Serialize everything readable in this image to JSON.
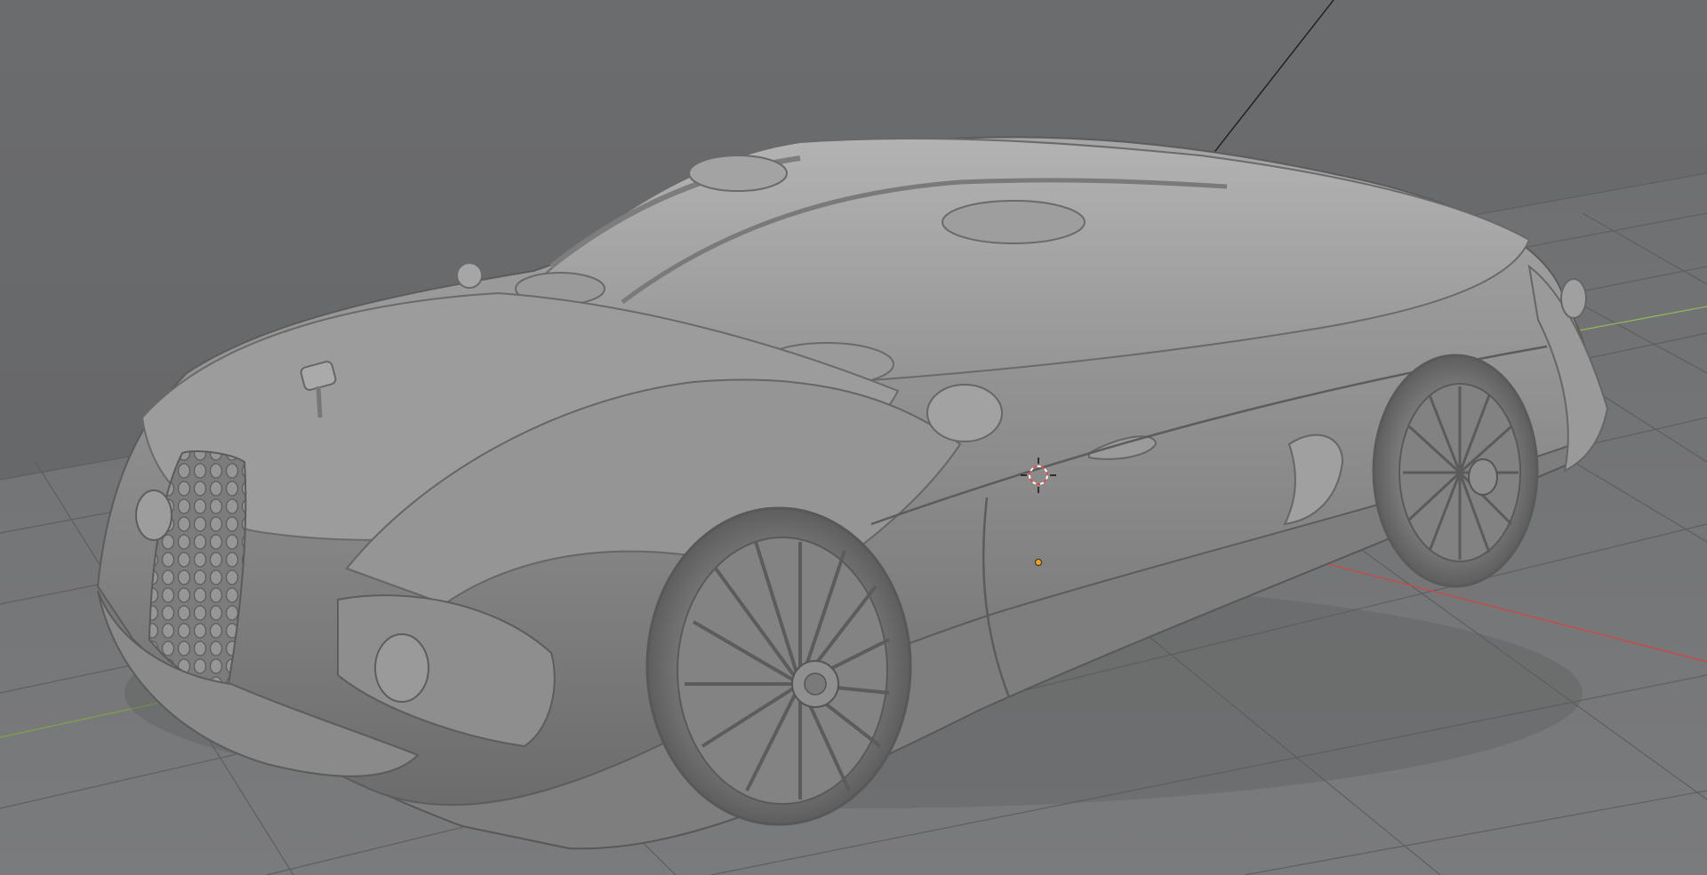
{
  "viewport": {
    "view": "3D Viewport",
    "shading": "solid",
    "background_color": "#67686a",
    "floor_color": "#727374",
    "object_color": "#8f8f8f"
  },
  "scene": {
    "object": "car",
    "cursor": "3d-cursor-icon",
    "origin": "object-origin-icon",
    "axes": {
      "x_axis_color": "#c84a4a",
      "y_axis_color": "#7fa34a"
    }
  }
}
